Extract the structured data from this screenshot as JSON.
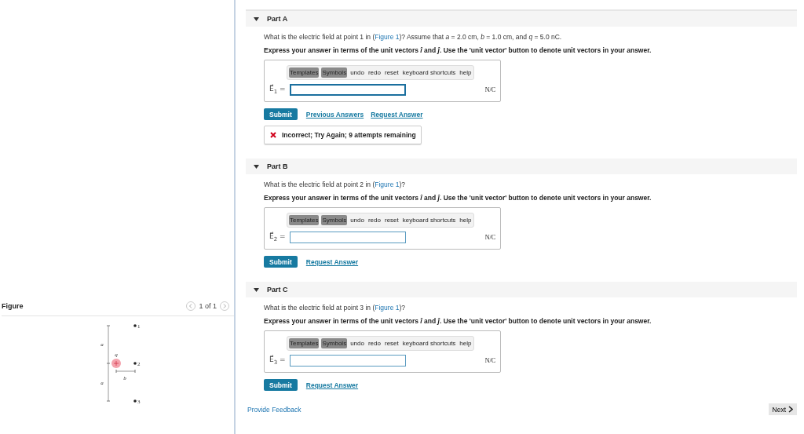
{
  "figure_panel": {
    "title": "Figure",
    "pager": "1 of 1",
    "labels": [
      {
        "kind": "point",
        "text": "1"
      },
      {
        "kind": "point",
        "text": "2"
      },
      {
        "kind": "point",
        "text": "3"
      },
      {
        "kind": "dim",
        "text": "a"
      },
      {
        "kind": "dim",
        "text": "a"
      },
      {
        "kind": "charge",
        "text": "q"
      },
      {
        "kind": "dim",
        "text": "b"
      }
    ]
  },
  "parts": [
    {
      "title": "Part A",
      "expanded": true,
      "question": "What is the electric field at point 1 in (",
      "figure_link": "Figure 1",
      "question_end": ")? Assume that *a* = 2.0 cm, *b* = 1.0 cm, and *q* = 5.0 nC.",
      "instruction": "Express your answer in terms of the unit vectors *î* and *ĵ*. Use the 'unit vector' button to denote unit vectors in your answer.",
      "toolbar": [
        "Templates",
        "Symbols",
        "undo",
        "redo",
        "reset",
        "keyboard shortcuts",
        "help"
      ],
      "label": "E⃗$_{1}$ =",
      "unit": "N/C",
      "focused": true,
      "submit": "Submit",
      "links": [
        "Previous Answers",
        "Request Answer"
      ],
      "feedback": "Incorrect; Try Again; 9 attempts remaining"
    },
    {
      "title": "Part B",
      "expanded": true,
      "question": "What is the electric field at point 2 in (",
      "figure_link": "Figure 1",
      "question_end": ")?",
      "instruction": "Express your answer in terms of the unit vectors *î* and *ĵ*. Use the 'unit vector' button to denote unit vectors in your answer.",
      "toolbar": [
        "Templates",
        "Symbols",
        "undo",
        "redo",
        "reset",
        "keyboard shortcuts",
        "help"
      ],
      "label": "E⃗$_{2}$ =",
      "unit": "N/C",
      "focused": false,
      "submit": "Submit",
      "links": [
        "Request Answer"
      ]
    },
    {
      "title": "Part C",
      "expanded": true,
      "question": "What is the electric field at point 3 in (",
      "figure_link": "Figure 1",
      "question_end": ")?",
      "instruction": "Express your answer in terms of the unit vectors *î* and *ĵ*. Use the 'unit vector' button to denote unit vectors in your answer.",
      "toolbar": [
        "Templates",
        "Symbols",
        "undo",
        "redo",
        "reset",
        "keyboard shortcuts",
        "help"
      ],
      "label": "E⃗$_{3}$ =",
      "unit": "N/C",
      "focused": false,
      "submit": "Submit",
      "links": [
        "Request Answer"
      ]
    }
  ],
  "footer": {
    "feedback_link": "Provide Feedback",
    "next": "Next"
  }
}
